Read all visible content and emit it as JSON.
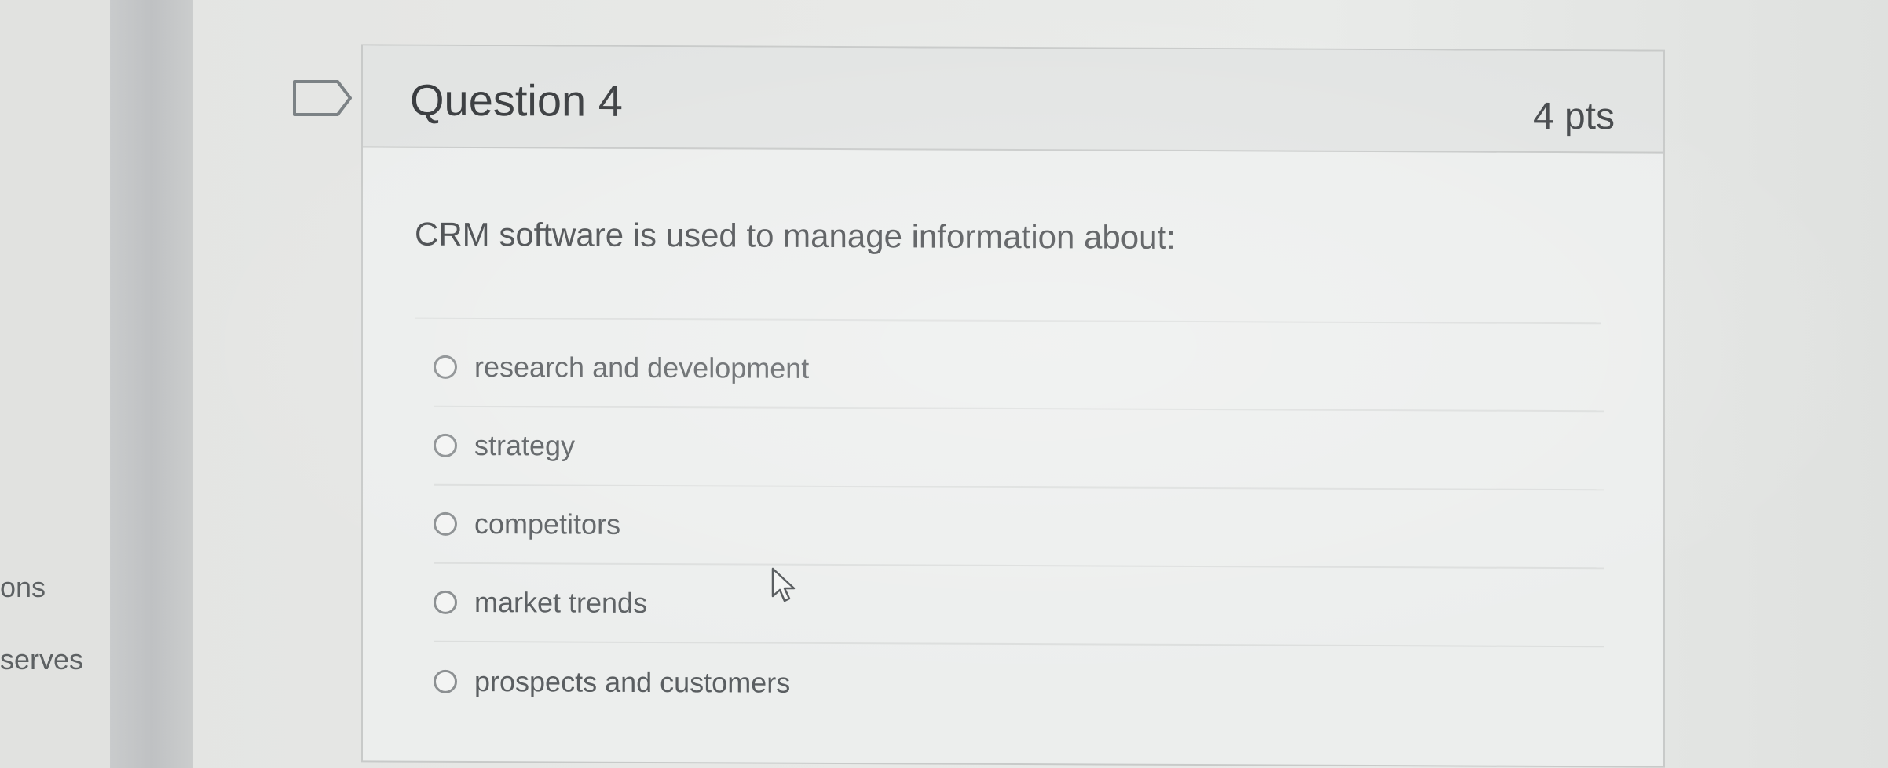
{
  "sidebar": {
    "items": [
      {
        "label": "ons"
      },
      {
        "label": "serves"
      }
    ]
  },
  "question": {
    "title": "Question 4",
    "points": "4 pts",
    "text": "CRM software is used to manage information about:",
    "flag_icon": "flag-icon",
    "answers": [
      {
        "label": "research and development",
        "selected": false
      },
      {
        "label": "strategy",
        "selected": false
      },
      {
        "label": "competitors",
        "selected": false
      },
      {
        "label": "market trends",
        "selected": false
      },
      {
        "label": "prospects and customers",
        "selected": false
      }
    ]
  },
  "colors": {
    "background": "#e7e8e6",
    "sidebar_divider": "#c2c4c6",
    "card_border": "#c8cac9",
    "text_dark": "#3a3d40",
    "text_answer": "#5a5e61"
  }
}
